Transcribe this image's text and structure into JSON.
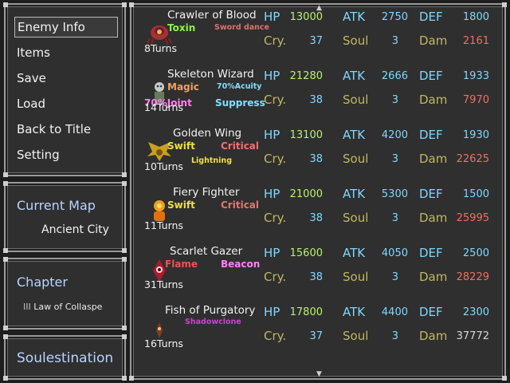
{
  "menu": {
    "items": [
      {
        "label": "Enemy Info",
        "selected": true
      },
      {
        "label": "Items"
      },
      {
        "label": "Save"
      },
      {
        "label": "Load"
      },
      {
        "label": "Back to Title"
      },
      {
        "label": "Setting"
      }
    ]
  },
  "map": {
    "title": "Current Map",
    "value": "Ancient City"
  },
  "chapter": {
    "title": "Chapter",
    "numeral": "III",
    "value": "Law of Collaspe"
  },
  "game_title": "Soulestination",
  "stat_labels": {
    "hp": "HP",
    "atk": "ATK",
    "def": "DEF",
    "cry": "Cry.",
    "soul": "Soul",
    "dam": "Dam"
  },
  "enemies": [
    {
      "name": "Crawler of Blood",
      "turns": "8Turns",
      "traits": [
        {
          "text": "Toxin",
          "color": "#8cf24a"
        },
        {
          "text": "Sword dance",
          "color": "#e0706c"
        }
      ],
      "hp": "13000",
      "atk": "2750",
      "def": "1800",
      "cry": "37",
      "soul": "3",
      "dam": "2161",
      "dam_color": "#f26f5e"
    },
    {
      "name": "Skeleton Wizard",
      "turns": "14Turns",
      "traits": [
        {
          "text": "Magic",
          "color": "#f0a060"
        },
        {
          "text": "70%Acuity",
          "color": "#7fe0ff"
        },
        {
          "text": "70%Joint",
          "color": "#ff7ff0"
        },
        {
          "text": "Suppress",
          "color": "#7fe0ff"
        }
      ],
      "hp": "21280",
      "atk": "2666",
      "def": "1933",
      "cry": "38",
      "soul": "3",
      "dam": "7970",
      "dam_color": "#f26f5e"
    },
    {
      "name": "Golden Wing",
      "turns": "10Turns",
      "traits": [
        {
          "text": "Swift",
          "color": "#f0e040"
        },
        {
          "text": "Critical",
          "color": "#f07070"
        },
        {
          "text": "Lightning",
          "color": "#f0e040"
        }
      ],
      "hp": "13100",
      "atk": "4200",
      "def": "1930",
      "cry": "38",
      "soul": "3",
      "dam": "22625",
      "dam_color": "#f26f5e"
    },
    {
      "name": "Fiery Fighter",
      "turns": "11Turns",
      "traits": [
        {
          "text": "Swift",
          "color": "#f0e040"
        },
        {
          "text": "Critical",
          "color": "#f07070"
        }
      ],
      "hp": "21000",
      "atk": "5300",
      "def": "1500",
      "cry": "38",
      "soul": "3",
      "dam": "25995",
      "dam_color": "#f26f5e"
    },
    {
      "name": "Scarlet Gazer",
      "turns": "31Turns",
      "traits": [
        {
          "text": "Flame",
          "color": "#f05050"
        },
        {
          "text": "Beacon",
          "color": "#ff7fff"
        }
      ],
      "hp": "15600",
      "atk": "4050",
      "def": "2500",
      "cry": "38",
      "soul": "3",
      "dam": "28229",
      "dam_color": "#f26f5e"
    },
    {
      "name": "Fish of Purgatory",
      "turns": "16Turns",
      "traits": [
        {
          "text": "Shadowclone",
          "color": "#d040d0"
        }
      ],
      "hp": "17800",
      "atk": "4400",
      "def": "2300",
      "cry": "37",
      "soul": "3",
      "dam": "37772",
      "dam_color": "#d8d8d8"
    }
  ],
  "colors": {
    "hp_val": "#b8f070",
    "atk_val": "#7fd7ff",
    "def_val": "#7fd7ff",
    "cry_val": "#7fd7ff",
    "soul_val": "#7fd7ff"
  }
}
